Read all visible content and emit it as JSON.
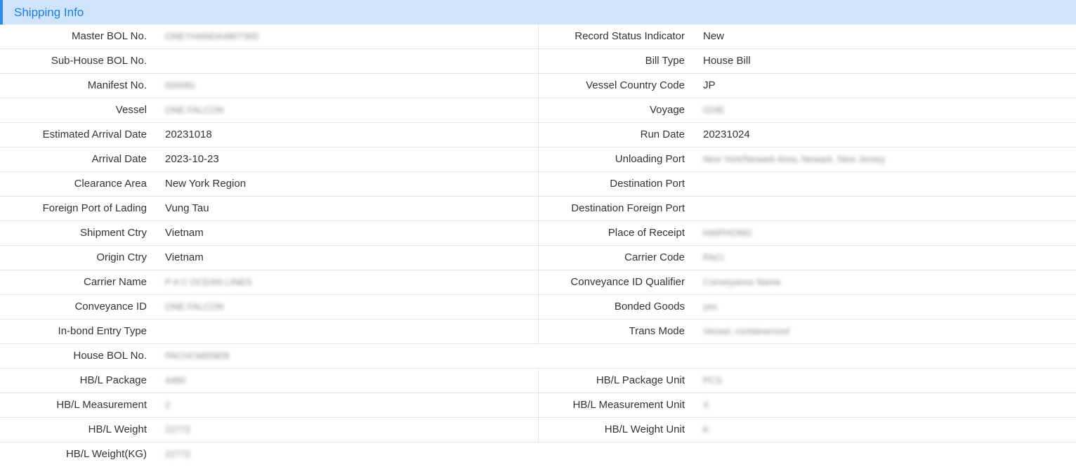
{
  "section": {
    "title": "Shipping Info"
  },
  "rows": [
    {
      "left": {
        "label": "Master BOL No.",
        "value": "ONEYHANDA4807300",
        "blur": true
      },
      "right": {
        "label": "Record Status Indicator",
        "value": "New",
        "blur": false
      }
    },
    {
      "left": {
        "label": "Sub-House BOL No.",
        "value": "",
        "blur": false
      },
      "right": {
        "label": "Bill Type",
        "value": "House Bill",
        "blur": false
      }
    },
    {
      "left": {
        "label": "Manifest No.",
        "value": "000081",
        "blur": true
      },
      "right": {
        "label": "Vessel Country Code",
        "value": "JP",
        "blur": false
      }
    },
    {
      "left": {
        "label": "Vessel",
        "value": "ONE FALCON",
        "blur": true
      },
      "right": {
        "label": "Voyage",
        "value": "024E",
        "blur": true
      }
    },
    {
      "left": {
        "label": "Estimated Arrival Date",
        "value": "20231018",
        "blur": false
      },
      "right": {
        "label": "Run Date",
        "value": "20231024",
        "blur": false
      }
    },
    {
      "left": {
        "label": "Arrival Date",
        "value": "2023-10-23",
        "blur": false
      },
      "right": {
        "label": "Unloading Port",
        "value": "New York/Newark Area, Newark, New Jersey",
        "blur": true
      }
    },
    {
      "left": {
        "label": "Clearance Area",
        "value": "New York Region",
        "blur": false
      },
      "right": {
        "label": "Destination Port",
        "value": "",
        "blur": false
      }
    },
    {
      "left": {
        "label": "Foreign Port of Lading",
        "value": "Vung Tau",
        "blur": false
      },
      "right": {
        "label": "Destination Foreign Port",
        "value": "",
        "blur": false
      }
    },
    {
      "left": {
        "label": "Shipment Ctry",
        "value": "Vietnam",
        "blur": false
      },
      "right": {
        "label": "Place of Receipt",
        "value": "HAIPHONG",
        "blur": true
      }
    },
    {
      "left": {
        "label": "Origin Ctry",
        "value": "Vietnam",
        "blur": false
      },
      "right": {
        "label": "Carrier Code",
        "value": "PACI",
        "blur": true
      }
    },
    {
      "left": {
        "label": "Carrier Name",
        "value": "P A C OCEAN LINES",
        "blur": true
      },
      "right": {
        "label": "Conveyance ID Qualifier",
        "value": "Conveyance Name",
        "blur": true
      }
    },
    {
      "left": {
        "label": "Conveyance ID",
        "value": "ONE FALCON",
        "blur": true
      },
      "right": {
        "label": "Bonded Goods",
        "value": "yes",
        "blur": true
      }
    },
    {
      "left": {
        "label": "In-bond Entry Type",
        "value": "",
        "blur": false
      },
      "right": {
        "label": "Trans Mode",
        "value": "Vessel, containerized",
        "blur": true
      }
    },
    {
      "left": {
        "label": "House BOL No.",
        "value": "PACHCM05809",
        "blur": true
      },
      "right": null
    },
    {
      "left": {
        "label": "HB/L Package",
        "value": "4480",
        "blur": true
      },
      "right": {
        "label": "HB/L Package Unit",
        "value": "PCS",
        "blur": true
      }
    },
    {
      "left": {
        "label": "HB/L Measurement",
        "value": "2",
        "blur": true
      },
      "right": {
        "label": "HB/L Measurement Unit",
        "value": "X",
        "blur": true
      }
    },
    {
      "left": {
        "label": "HB/L Weight",
        "value": "22772",
        "blur": true
      },
      "right": {
        "label": "HB/L Weight Unit",
        "value": "K",
        "blur": true
      }
    },
    {
      "left": {
        "label": "HB/L Weight(KG)",
        "value": "22772",
        "blur": true
      },
      "right": null
    }
  ]
}
